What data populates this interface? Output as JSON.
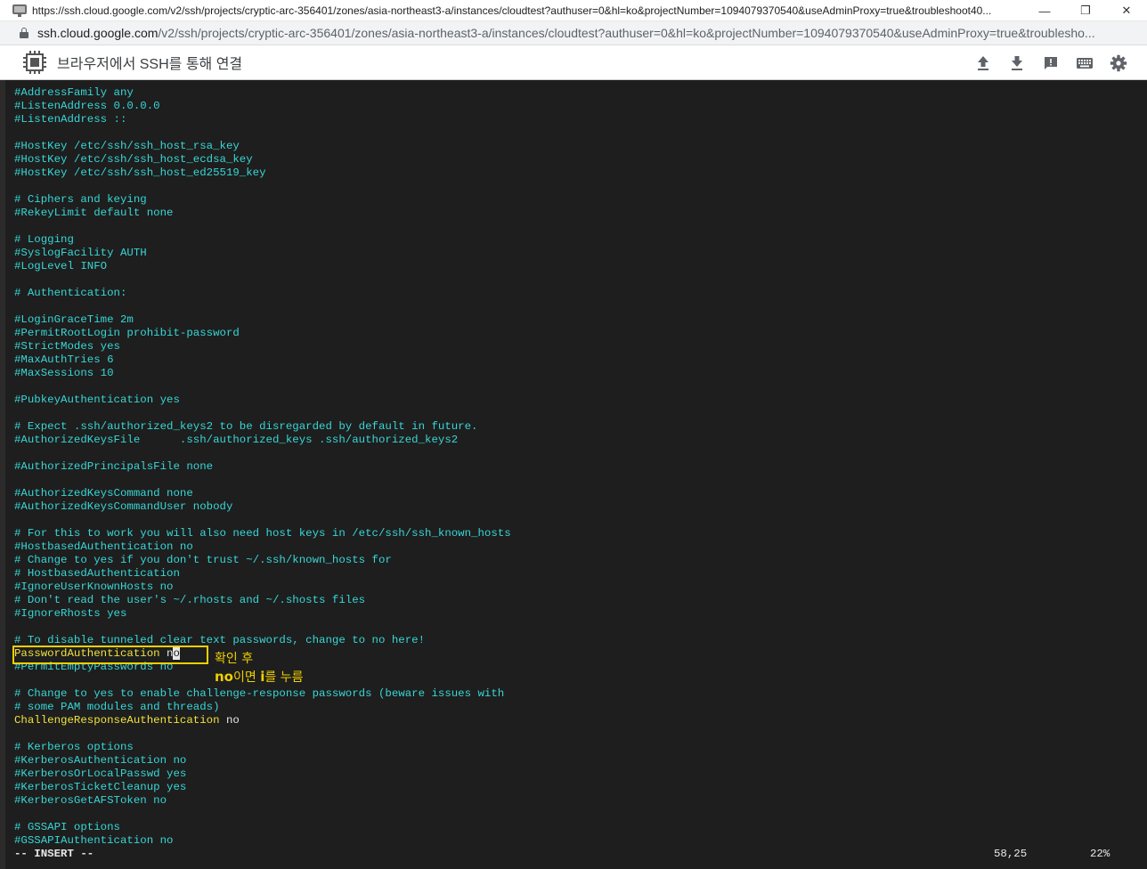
{
  "window": {
    "title": "https://ssh.cloud.google.com/v2/ssh/projects/cryptic-arc-356401/zones/asia-northeast3-a/instances/cloudtest?authuser=0&hl=ko&projectNumber=1094079370540&useAdminProxy=true&troubleshoot40...",
    "minimize_glyph": "—",
    "restore_glyph": "❐",
    "close_glyph": "✕"
  },
  "address": {
    "host": "ssh.cloud.google.com",
    "path": "/v2/ssh/projects/cryptic-arc-356401/zones/asia-northeast3-a/instances/cloudtest?authuser=0&hl=ko&projectNumber=1094079370540&useAdminProxy=true&troublesho..."
  },
  "app": {
    "title": "브라우저에서 SSH를 통해 연결",
    "actions": [
      "upload-icon",
      "download-icon",
      "feedback-icon",
      "keyboard-icon",
      "gear-icon"
    ]
  },
  "terminal": {
    "lines": [
      "#AddressFamily any",
      "#ListenAddress 0.0.0.0",
      "#ListenAddress ::",
      "",
      "#HostKey /etc/ssh/ssh_host_rsa_key",
      "#HostKey /etc/ssh/ssh_host_ecdsa_key",
      "#HostKey /etc/ssh/ssh_host_ed25519_key",
      "",
      "# Ciphers and keying",
      "#RekeyLimit default none",
      "",
      "# Logging",
      "#SyslogFacility AUTH",
      "#LogLevel INFO",
      "",
      "# Authentication:",
      "",
      "#LoginGraceTime 2m",
      "#PermitRootLogin prohibit-password",
      "#StrictModes yes",
      "#MaxAuthTries 6",
      "#MaxSessions 10",
      "",
      "#PubkeyAuthentication yes",
      "",
      "# Expect .ssh/authorized_keys2 to be disregarded by default in future.",
      "#AuthorizedKeysFile      .ssh/authorized_keys .ssh/authorized_keys2",
      "",
      "#AuthorizedPrincipalsFile none",
      "",
      "#AuthorizedKeysCommand none",
      "#AuthorizedKeysCommandUser nobody",
      "",
      "# For this to work you will also need host keys in /etc/ssh/ssh_known_hosts",
      "#HostbasedAuthentication no",
      "# Change to yes if you don't trust ~/.ssh/known_hosts for",
      "# HostbasedAuthentication",
      "#IgnoreUserKnownHosts no",
      "# Don't read the user's ~/.rhosts and ~/.shosts files",
      "#IgnoreRhosts yes",
      "",
      "# To disable tunneled clear text passwords, change to no here!"
    ],
    "password_line": {
      "key": "PasswordAuthentication ",
      "value_before_cursor": "n",
      "cursor_char": "o"
    },
    "lines_after": [
      "#PermitEmptyPasswords no",
      "",
      "# Change to yes to enable challenge-response passwords (beware issues with",
      "# some PAM modules and threads)"
    ],
    "challenge_line": {
      "key": "ChallengeResponseAuthentication ",
      "value": "no"
    },
    "lines_end": [
      "",
      "# Kerberos options",
      "#KerberosAuthentication no",
      "#KerberosOrLocalPasswd yes",
      "#KerberosTicketCleanup yes",
      "#KerberosGetAFSToken no",
      "",
      "# GSSAPI options",
      "#GSSAPIAuthentication no"
    ],
    "status": {
      "mode": "-- INSERT --",
      "position": "58,25",
      "percent": "22%"
    }
  },
  "annotation": {
    "line1": "확인 후",
    "line2_bold_a": "no",
    "line2_mid": "이면 ",
    "line2_bold_b": "i",
    "line2_end": "를 누름",
    "color": "#f0d000"
  }
}
